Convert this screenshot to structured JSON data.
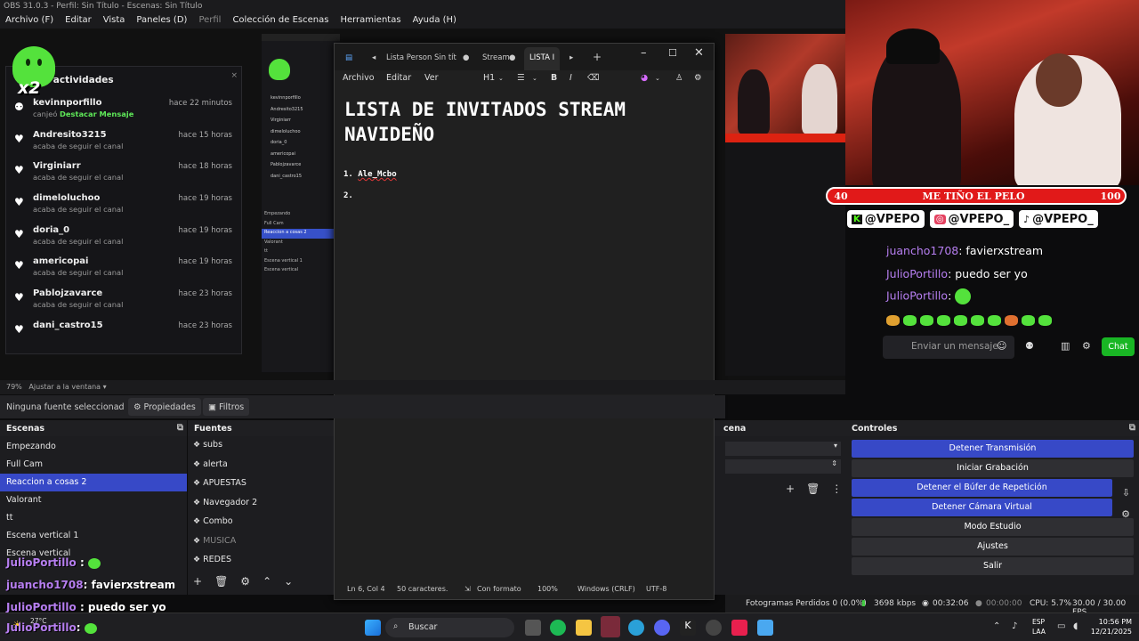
{
  "obs": {
    "title": "OBS 31.0.3 - Perfil: Sin Título - Escenas: Sin Título",
    "menu": [
      "Archivo (F)",
      "Editar",
      "Vista",
      "Paneles (D)",
      "Perfil",
      "Colección de Escenas",
      "Herramientas",
      "Ayuda (H)"
    ],
    "zoom": "79%",
    "zoom_option": "Ajustar a la ventana",
    "no_source": "Ninguna fuente seleccionad",
    "properties_label": "Propiedades",
    "filters_label": "Filtros"
  },
  "activity": {
    "title": "e actividades",
    "badge": "x2",
    "items": [
      {
        "name": "kevinnporfillo",
        "time": "hace 22 minutos",
        "desc": "canjeó",
        "highlight": "Destacar Mensaje",
        "icon": "points-icon"
      },
      {
        "name": "Andresito3215",
        "time": "hace 15 horas",
        "desc": "acaba de seguir el canal",
        "icon": "heart-icon"
      },
      {
        "name": "Virginiarr",
        "time": "hace 18 horas",
        "desc": "acaba de seguir el canal",
        "icon": "heart-icon"
      },
      {
        "name": "dimeloluchoo",
        "time": "hace 19 horas",
        "desc": "acaba de seguir el canal",
        "icon": "heart-icon"
      },
      {
        "name": "doria_0",
        "time": "hace 19 horas",
        "desc": "acaba de seguir el canal",
        "icon": "heart-icon"
      },
      {
        "name": "americopai",
        "time": "hace 19 horas",
        "desc": "acaba de seguir el canal",
        "icon": "heart-icon"
      },
      {
        "name": "Pablojzavarce",
        "time": "hace 23 horas",
        "desc": "acaba de seguir el canal",
        "icon": "heart-icon"
      },
      {
        "name": "dani_castro15",
        "time": "hace 23 horas",
        "desc": "",
        "icon": "heart-icon"
      }
    ]
  },
  "notepad": {
    "tabs": [
      "Lista Person",
      "Sin tít",
      "Stream",
      "LISTA I"
    ],
    "menu": [
      "Archivo",
      "Editar",
      "Ver"
    ],
    "heading_level": "H1",
    "heading": "LISTA DE INVITADOS STREAM NAVIDEÑO",
    "list": [
      {
        "num": "1.",
        "text": "Ale_Mcbo"
      },
      {
        "num": "2.",
        "text": ""
      }
    ],
    "status": {
      "position": "Ln 6, Col 4",
      "chars": "50 caracteres.",
      "format": "Con formato",
      "zoom": "100%",
      "line_ending": "Windows (CRLF)",
      "encoding": "UTF-8"
    }
  },
  "stream_overlay": {
    "goal_start": "40",
    "goal_text": "ME TIÑO EL PELO",
    "goal_end": "100",
    "socials": [
      "@VPEPO",
      "@VPEPO_",
      "@VPEPO_"
    ],
    "chat": [
      {
        "user": "juancho1708",
        "msg": "favierxstream"
      },
      {
        "user": "JulioPortillo",
        "msg": "puedo ser yo"
      },
      {
        "user": "JulioPortillo",
        "msg": ""
      }
    ],
    "chat_placeholder": "Enviar un mensaje",
    "chat_button": "Chat"
  },
  "scenes": {
    "title": "Escenas",
    "items": [
      "Empezando",
      "Full Cam",
      "Reaccion a cosas 2",
      "Valorant",
      "tt",
      "Escena vertical 1",
      "Escena vertical"
    ],
    "selected": 2
  },
  "sources": {
    "title": "Fuentes",
    "items": [
      {
        "name": "subs",
        "dim": false
      },
      {
        "name": "alerta",
        "dim": false
      },
      {
        "name": "APUESTAS",
        "dim": false
      },
      {
        "name": "Navegador 2",
        "dim": false
      },
      {
        "name": "Combo",
        "dim": false
      },
      {
        "name": "MUSICA",
        "dim": true
      },
      {
        "name": "REDES",
        "dim": false
      }
    ]
  },
  "mixer": {
    "title": "cena"
  },
  "controls": {
    "title": "Controles",
    "buttons": [
      {
        "label": "Detener Transmisión",
        "style": "blue"
      },
      {
        "label": "Iniciar Grabación",
        "style": "grey"
      },
      {
        "label": "Detener el Búfer de Repetición",
        "style": "blue"
      },
      {
        "label": "Detener Cámara Virtual",
        "style": "blue"
      },
      {
        "label": "Modo Estudio",
        "style": "grey"
      },
      {
        "label": "Ajustes",
        "style": "grey"
      },
      {
        "label": "Salir",
        "style": "grey"
      }
    ]
  },
  "obs_status": {
    "dropped": "Fotogramas Perdidos 0 (0.0%)",
    "bitrate": "3698 kbps",
    "stream_time": "00:32:06",
    "rec_time": "00:00:00",
    "cpu": "CPU: 5.7%",
    "fps": "30.00 / 30.00 FPS"
  },
  "overlay_chat": [
    {
      "user": "JulioPortillo",
      "msg": ":"
    },
    {
      "user": "juancho1708",
      "msg": ": favierxstream"
    },
    {
      "user": "JulioPortillo",
      "msg": ": puedo ser yo"
    },
    {
      "user": "JulioPortillo",
      "msg": ":"
    }
  ],
  "taskbar": {
    "search": "Buscar",
    "weather": "27°C",
    "lang1": "ESP",
    "lang2": "LAA",
    "time": "10:56 PM",
    "date": "12/21/2025"
  },
  "colors": {
    "accent": "#3749c7",
    "ghost": "#54e23c",
    "goal": "#e11919",
    "chat_user": "#b67ef0"
  }
}
